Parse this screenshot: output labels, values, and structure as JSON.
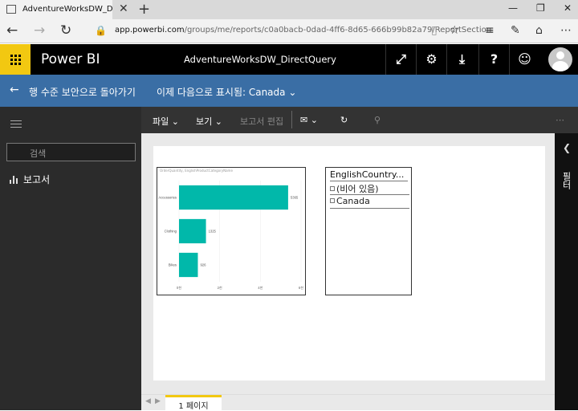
{
  "browser": {
    "tab_title": "AdventureWorksDW_Dir",
    "tab_close": "✕",
    "new_tab": "+",
    "url_host": "app.powerbi.com",
    "url_path": "/groups/me/reports/c0a0bacb-0dad-4ff6-8d65-666b99b82a79/ReportSection"
  },
  "header": {
    "brand": "Power BI",
    "report_title": "AdventureWorksDW_DirectQuery"
  },
  "rls_bar": {
    "back_label": "행 수준 보안으로 돌아가기",
    "view_as_label": "이제 다음으로 표시됨: Canada ⌄"
  },
  "left_pane": {
    "search_placeholder": "검색",
    "reports_label": "보고서"
  },
  "toolbar": {
    "file": "파일 ⌄",
    "view": "보기 ⌄",
    "edit_report": "보고서 편집"
  },
  "chart_data": {
    "type": "bar",
    "orientation": "horizontal",
    "title": "OrderQuantity, EnglishProductCategoryName",
    "categories": [
      "Accessories",
      "Clothing",
      "Bikes"
    ],
    "values": [
      5365,
      1325,
      926
    ],
    "data_labels": [
      "5365",
      "1325",
      "926"
    ],
    "xlim": [
      0,
      6000
    ],
    "x_ticks": [
      0,
      2000,
      4000,
      6000
    ],
    "x_tick_labels": [
      "0천",
      "2천",
      "4천",
      "6천"
    ],
    "bar_color": "#01b8aa",
    "grid": true
  },
  "slicer": {
    "header": "EnglishCountry...",
    "items": [
      "(비어 있음)",
      "Canada"
    ]
  },
  "right_pane": {
    "label": "필터"
  },
  "page_tabs": {
    "active": "1 페이지"
  },
  "colors": {
    "accent_yellow": "#f2c811",
    "rls_blue": "#3a6ea5",
    "bar_teal": "#01b8aa"
  }
}
